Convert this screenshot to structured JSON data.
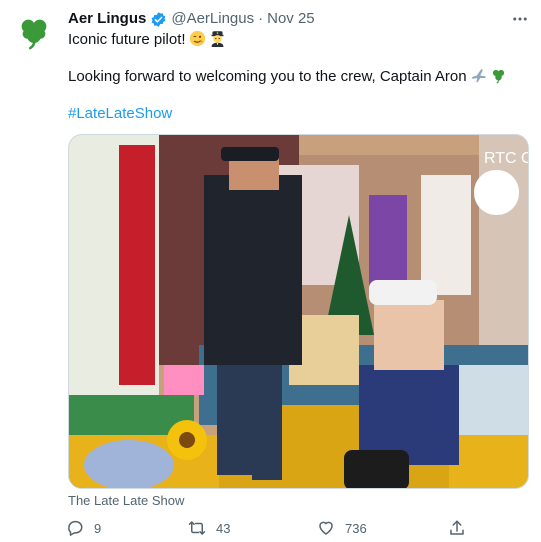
{
  "author": {
    "name": "Aer Lingus",
    "handle": "@AerLingus",
    "separator": "·",
    "date": "Nov 25"
  },
  "tweet": {
    "line1": "Iconic future pilot!",
    "line2": "Looking forward to welcoming you to the crew, Captain Aron",
    "hashtag": "#LateLateShow"
  },
  "media": {
    "sign_text": "RTC ON"
  },
  "caption": "The Late Late Show",
  "actions": {
    "reply_count": "9",
    "retweet_count": "43",
    "like_count": "736"
  },
  "colors": {
    "accent": "#1d9bf0",
    "shamrock": "#3a9a3a",
    "muted": "#536471"
  }
}
